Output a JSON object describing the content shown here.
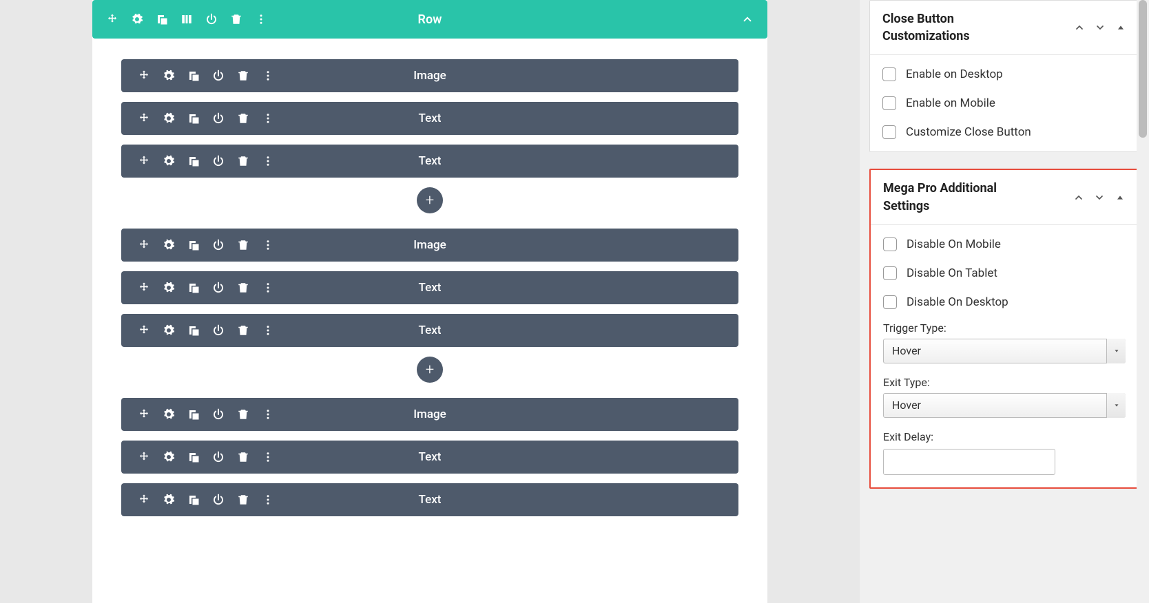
{
  "row": {
    "title": "Row"
  },
  "modules": [
    {
      "title": "Image"
    },
    {
      "title": "Text"
    },
    {
      "title": "Text"
    },
    {
      "title": "Image"
    },
    {
      "title": "Text"
    },
    {
      "title": "Text"
    },
    {
      "title": "Image"
    },
    {
      "title": "Text"
    },
    {
      "title": "Text"
    }
  ],
  "sidebar": {
    "close_btn": {
      "title": "Close Button Customizations",
      "opts": [
        {
          "label": "Enable on Desktop"
        },
        {
          "label": "Enable on Mobile"
        },
        {
          "label": "Customize Close Button"
        }
      ]
    },
    "mega": {
      "title": "Mega Pro Additional Settings",
      "opts": [
        {
          "label": "Disable On Mobile"
        },
        {
          "label": "Disable On Tablet"
        },
        {
          "label": "Disable On Desktop"
        }
      ],
      "trigger_label": "Trigger Type:",
      "trigger_value": "Hover",
      "exit_label": "Exit Type:",
      "exit_value": "Hover",
      "delay_label": "Exit Delay:",
      "delay_value": ""
    }
  }
}
